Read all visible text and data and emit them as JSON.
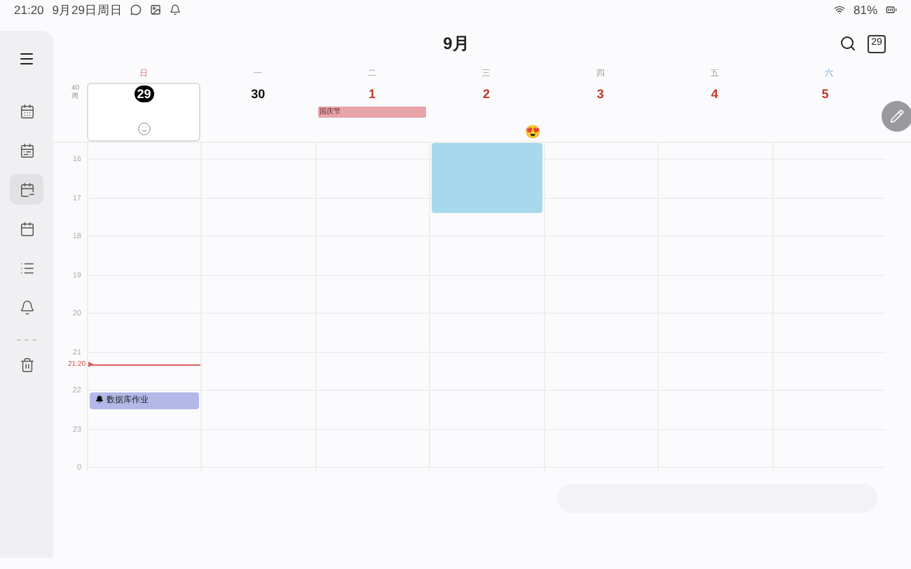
{
  "status_bar": {
    "time": "21:20",
    "date": "9月29日周日",
    "battery": "81%"
  },
  "header": {
    "title": "9月",
    "today_button": "29"
  },
  "sidebar": {
    "items": [
      {
        "selected": false
      },
      {
        "selected": false
      },
      {
        "selected": true
      },
      {
        "selected": false
      },
      {
        "selected": false
      },
      {
        "selected": false
      },
      {
        "selected": false
      }
    ]
  },
  "week_label": "40周",
  "days": [
    {
      "weekday": "日",
      "kind": "sunday",
      "date": "29",
      "selected": true,
      "events": [
        {
          "kind": "task",
          "title": "数据库作业",
          "color": "#b3b8e8",
          "reminder": true
        }
      ]
    },
    {
      "weekday": "一",
      "kind": "weekday",
      "date": "30",
      "selected": false,
      "holiday": false
    },
    {
      "weekday": "二",
      "kind": "weekday",
      "date": "1",
      "selected": false,
      "holiday": true,
      "all_day_events": [
        {
          "title": "国庆节",
          "color": "#e8a4a8"
        }
      ]
    },
    {
      "weekday": "三",
      "kind": "weekday",
      "date": "2",
      "selected": false,
      "holiday": true,
      "mood": "😍",
      "events": [
        {
          "kind": "block",
          "color": "#a6d9ec",
          "reminder": false
        }
      ]
    },
    {
      "weekday": "四",
      "kind": "weekday",
      "date": "3",
      "selected": false,
      "holiday": true
    },
    {
      "weekday": "五",
      "kind": "weekday",
      "date": "4",
      "selected": false,
      "holiday": true
    },
    {
      "weekday": "六",
      "kind": "saturday",
      "date": "5",
      "selected": false,
      "holiday": true
    }
  ],
  "hours": [
    "16",
    "17",
    "18",
    "19",
    "20",
    "21",
    "22",
    "23",
    "0"
  ],
  "now": {
    "label": "21:20"
  }
}
